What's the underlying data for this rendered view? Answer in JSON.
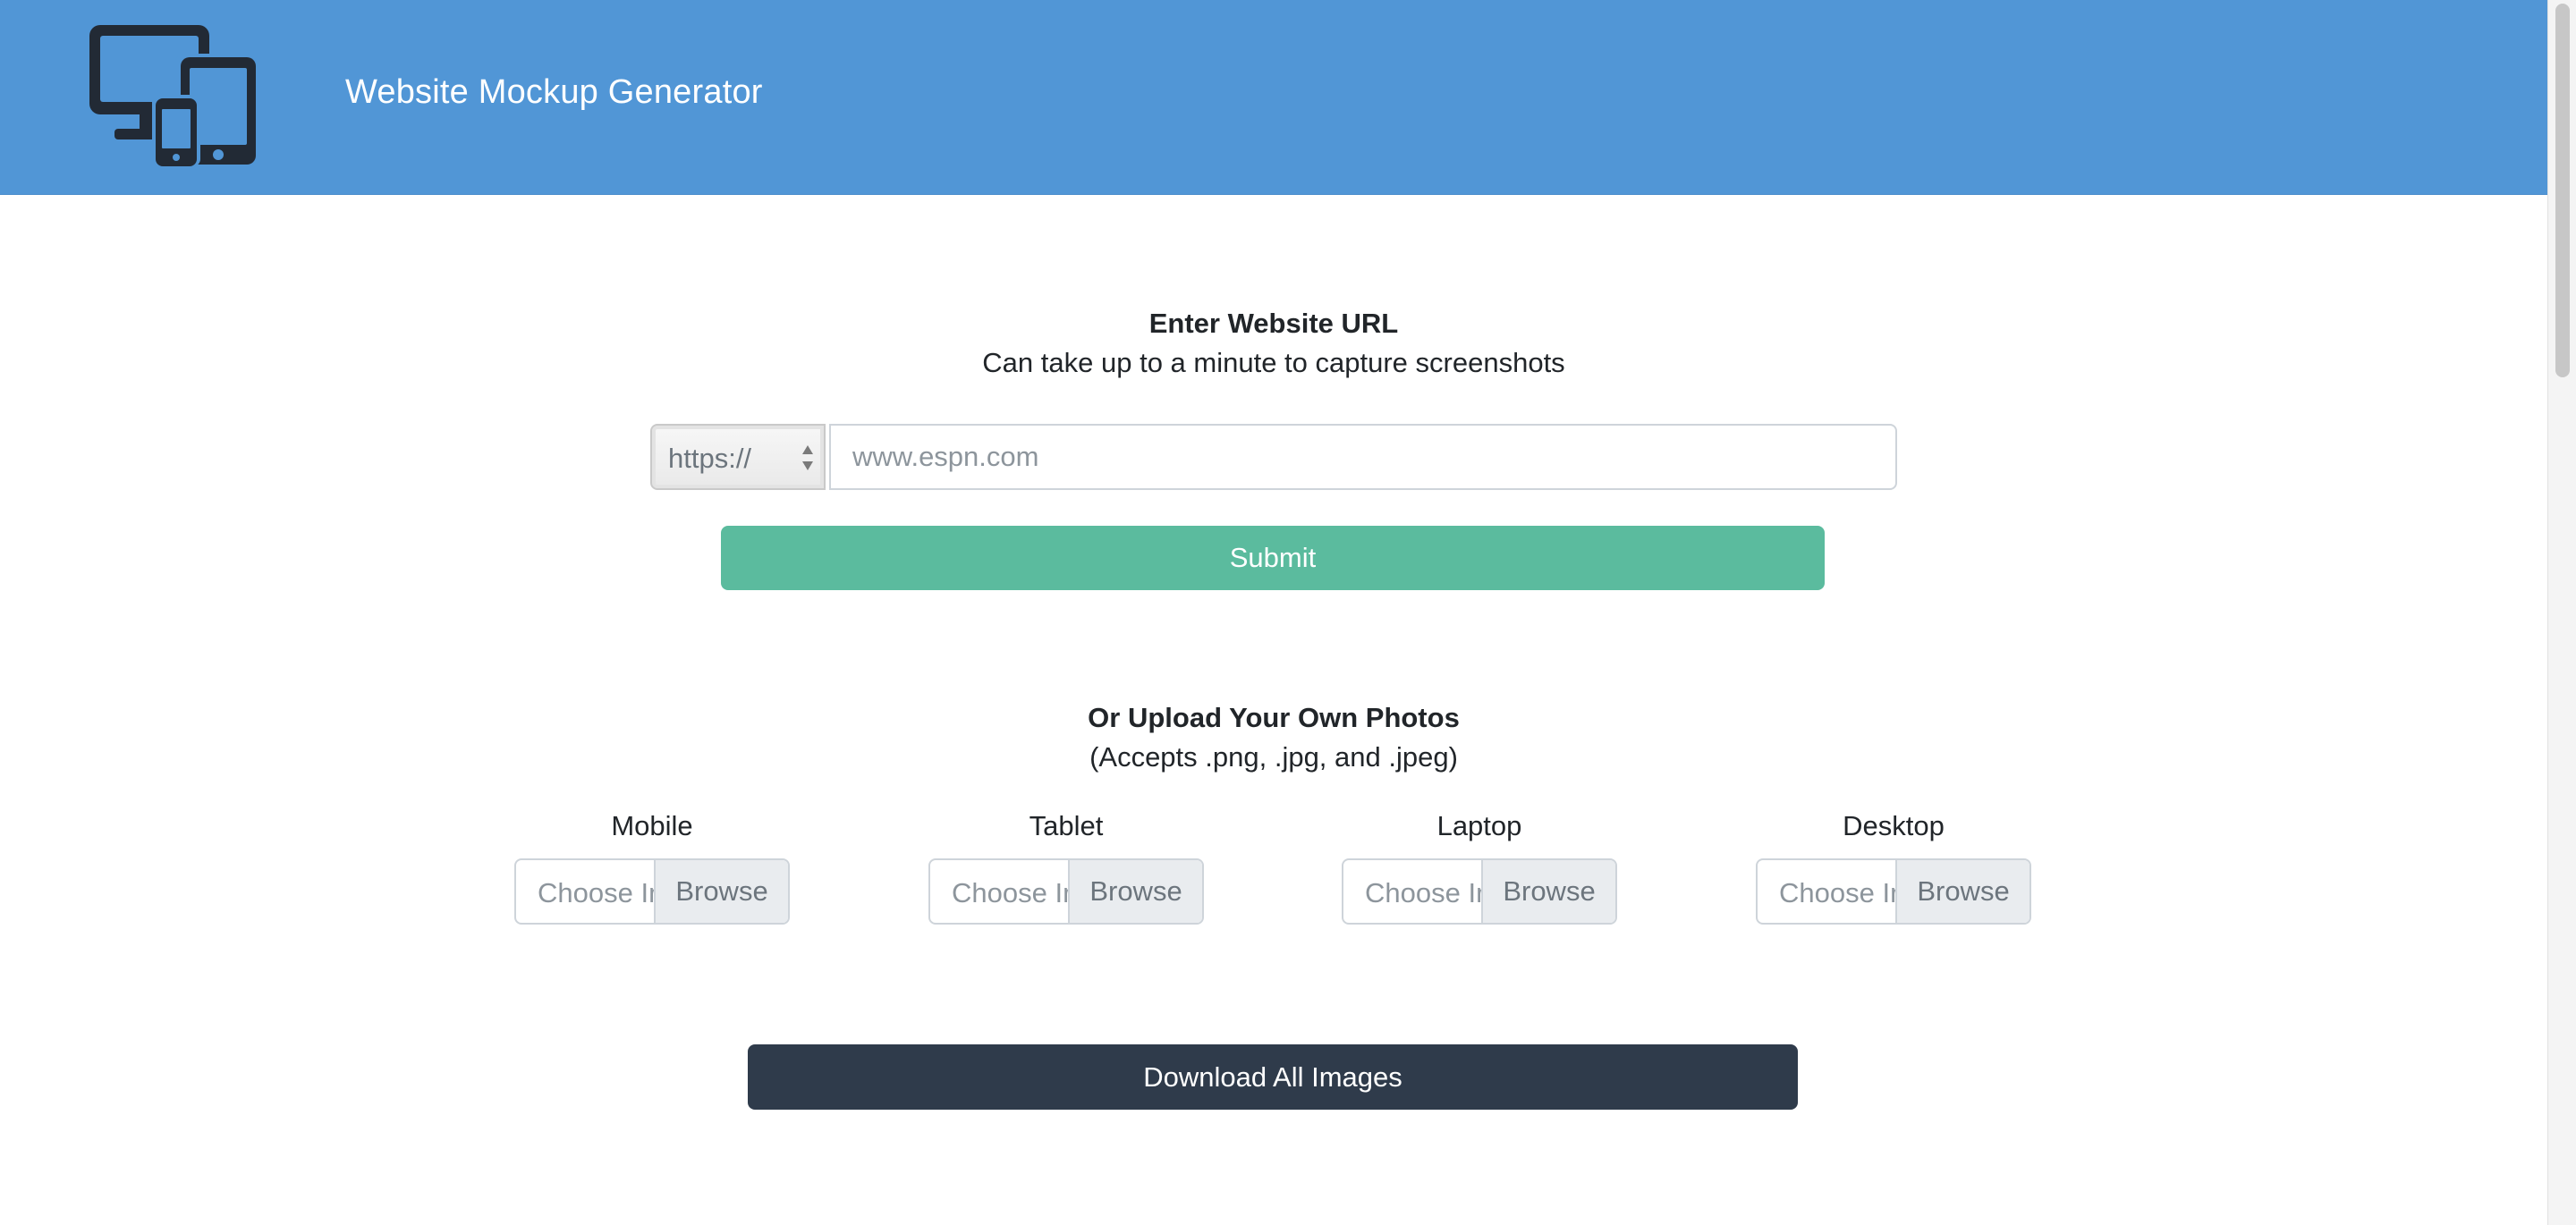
{
  "header": {
    "logo_icon": "devices-icon",
    "title": "Website Mockup Generator",
    "background_color": "#5196d6"
  },
  "url_section": {
    "heading": "Enter Website URL",
    "subheading": "Can take up to a minute to capture screenshots",
    "protocol_selected": "https://",
    "url_placeholder": "www.espn.com",
    "url_value": "",
    "submit_label": "Submit",
    "submit_color": "#5bbb9e"
  },
  "upload_section": {
    "heading": "Or Upload Your Own Photos",
    "subheading": "(Accepts .png, .jpg, and .jpeg)",
    "devices": [
      {
        "label": "Mobile",
        "placeholder": "Choose Image",
        "browse_label": "Browse"
      },
      {
        "label": "Tablet",
        "placeholder": "Choose Image",
        "browse_label": "Browse"
      },
      {
        "label": "Laptop",
        "placeholder": "Choose Image",
        "browse_label": "Browse"
      },
      {
        "label": "Desktop",
        "placeholder": "Choose Image",
        "browse_label": "Browse"
      }
    ]
  },
  "download": {
    "label": "Download All Images",
    "color": "#2f3b4b"
  }
}
